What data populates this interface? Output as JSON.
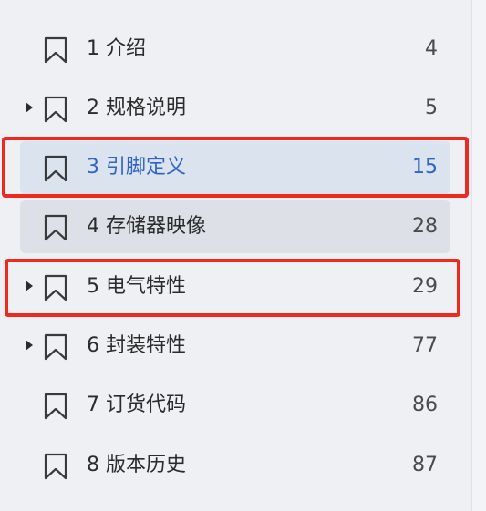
{
  "outline": {
    "items": [
      {
        "label": "1 介绍",
        "page": "4",
        "expandable": false,
        "state": "normal"
      },
      {
        "label": "2 规格说明",
        "page": "5",
        "expandable": true,
        "state": "normal"
      },
      {
        "label": "3 引脚定义",
        "page": "15",
        "expandable": false,
        "state": "selected"
      },
      {
        "label": "4 存储器映像",
        "page": "28",
        "expandable": false,
        "state": "hovered"
      },
      {
        "label": "5 电气特性",
        "page": "29",
        "expandable": true,
        "state": "normal"
      },
      {
        "label": "6 封装特性",
        "page": "77",
        "expandable": true,
        "state": "normal"
      },
      {
        "label": "7 订货代码",
        "page": "86",
        "expandable": false,
        "state": "normal"
      },
      {
        "label": "8 版本历史",
        "page": "87",
        "expandable": false,
        "state": "normal"
      }
    ]
  },
  "colors": {
    "selected_text": "#2f63c8",
    "selected_background": "#dbe3ee",
    "hover_background": "#dde0e6",
    "highlight_border": "#ee2a1e"
  },
  "icons": {
    "bookmark": "bookmark-icon",
    "expand": "triangle-right-icon"
  }
}
